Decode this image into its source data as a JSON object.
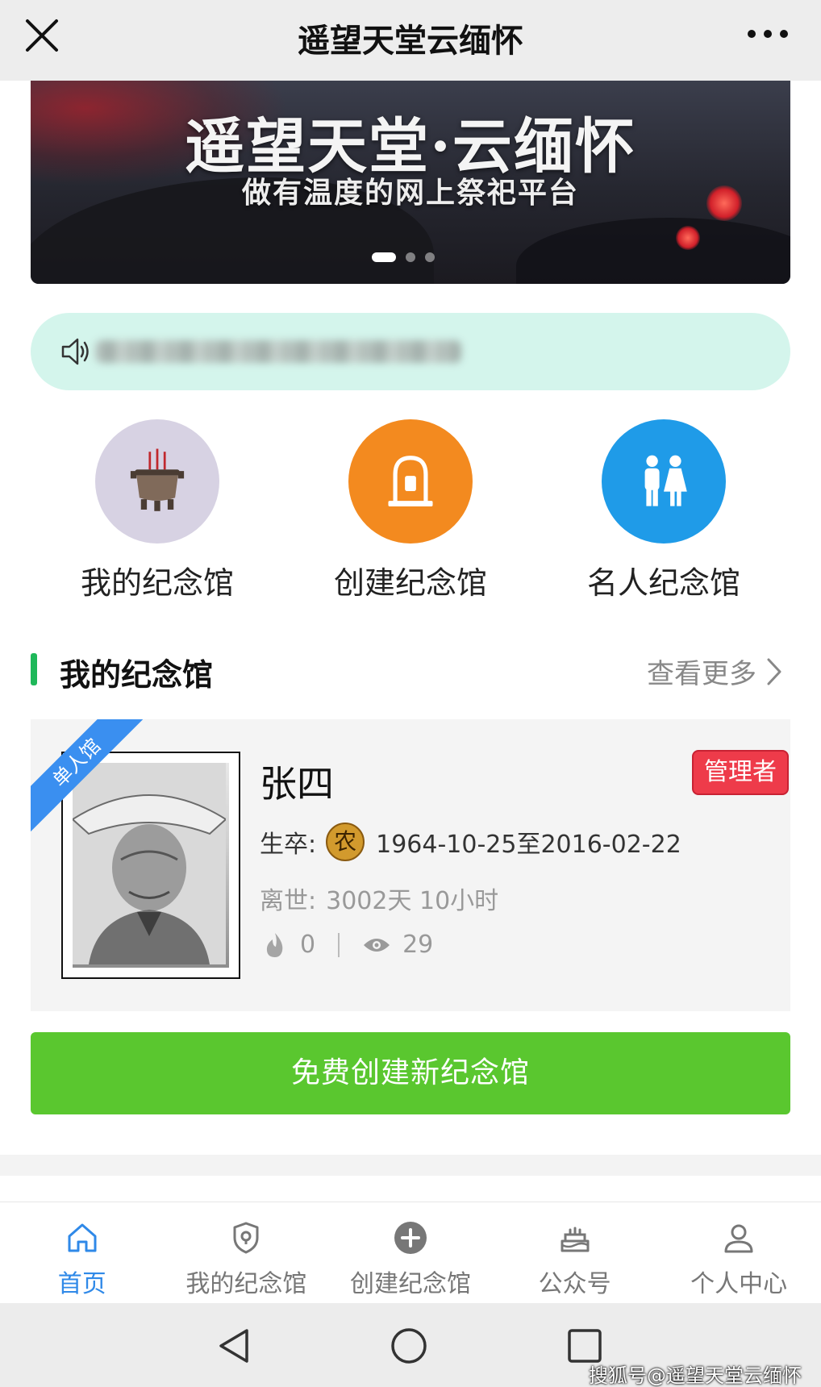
{
  "header": {
    "title": "遥望天堂云缅怀",
    "close_icon": "close-icon",
    "more_icon": "more-dots-icon"
  },
  "banner": {
    "title": "遥望天堂·云缅怀",
    "subtitle": "做有温度的网上祭祀平台",
    "slides": 3,
    "active_slide": 1
  },
  "notice": {
    "icon": "speaker-icon",
    "text_blurred": true
  },
  "shortcuts": [
    {
      "label": "我的纪念馆",
      "icon": "incense-burner-icon",
      "color": "#d7d2e3"
    },
    {
      "label": "创建纪念馆",
      "icon": "tombstone-icon",
      "color": "#f38a1f"
    },
    {
      "label": "名人纪念馆",
      "icon": "people-icon",
      "color": "#1f9be8"
    }
  ],
  "section": {
    "title": "我的纪念馆",
    "more_label": "查看更多",
    "accent": "#1fb85a"
  },
  "memorial": {
    "ribbon": "单人馆",
    "name": "张四",
    "badge": "管理者",
    "dates_label": "生卒:",
    "zodiac": "农",
    "dates": "1964-10-25至2016-02-22",
    "passed_label": "离世:",
    "passed": "3002天 10小时",
    "flames": "0",
    "views": "29"
  },
  "create_button": "免费创建新纪念馆",
  "bottom_nav": [
    {
      "label": "首页",
      "icon": "home-icon",
      "active": true
    },
    {
      "label": "我的纪念馆",
      "icon": "shield-location-icon",
      "active": false
    },
    {
      "label": "创建纪念馆",
      "icon": "plus-circle-icon",
      "active": false
    },
    {
      "label": "公众号",
      "icon": "cake-icon",
      "active": false
    },
    {
      "label": "个人中心",
      "icon": "user-icon",
      "active": false
    }
  ],
  "system_bar": {
    "watermark": "搜狐号@遥望天堂云缅怀"
  },
  "colors": {
    "green_button": "#5ac72f",
    "active_nav": "#2f89e8",
    "admin_badge": "#ee3b4a",
    "ribbon": "#3a8ff0"
  }
}
